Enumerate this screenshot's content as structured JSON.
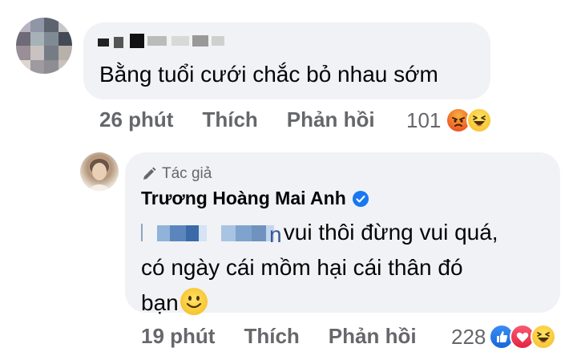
{
  "comment": {
    "author_name": "",
    "text": "Bằng tuổi cưới chắc bỏ nhau sớm",
    "time": "26 phút",
    "like_label": "Thích",
    "reply_label": "Phản hồi",
    "reaction_count": "101",
    "reactions": [
      "angry-icon",
      "laughing-icon"
    ]
  },
  "reply": {
    "author_badge": "Tác giả",
    "author_name": "Trương Hoàng Mai Anh",
    "mention_tail": "n",
    "text_line1": " vui thôi đừng vui quá,",
    "text_line2": "có ngày cái mồm hại cái thân đó",
    "text_line3": "bạn",
    "time": "19 phút",
    "like_label": "Thích",
    "reply_label": "Phản hồi",
    "reaction_count": "228",
    "reactions": [
      "like-icon",
      "love-icon",
      "laughing-icon"
    ]
  },
  "colors": {
    "bubble": "#f0f2f5",
    "meta_text": "#65676b",
    "verified": "#1877f2",
    "angry": "#f05a24",
    "love": "#f33e58"
  }
}
